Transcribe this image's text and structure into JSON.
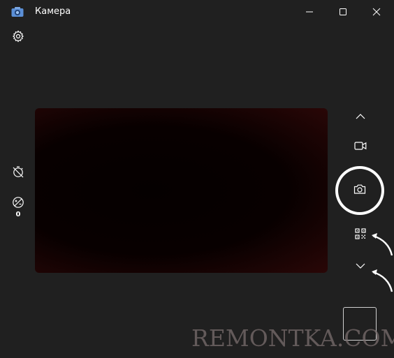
{
  "window": {
    "title": "Камера",
    "minimize_icon": "minimize-icon",
    "maximize_icon": "maximize-icon",
    "close_icon": "close-icon"
  },
  "left_toolbar": {
    "settings_icon": "gear-icon",
    "timer_icon": "timer-off-icon",
    "brightness_icon": "exposure-icon",
    "brightness_value": "0"
  },
  "right_toolbar": {
    "collapse_up_icon": "chevron-up-icon",
    "video_mode_icon": "video-camera-icon",
    "photo_shutter_icon": "camera-icon",
    "qr_mode_icon": "qr-code-icon",
    "expand_down_icon": "chevron-down-icon"
  },
  "watermark": "REMONTKA.COM",
  "colors": {
    "background": "#202020",
    "preview_edge": "#2a0707",
    "foreground": "#ffffff"
  }
}
